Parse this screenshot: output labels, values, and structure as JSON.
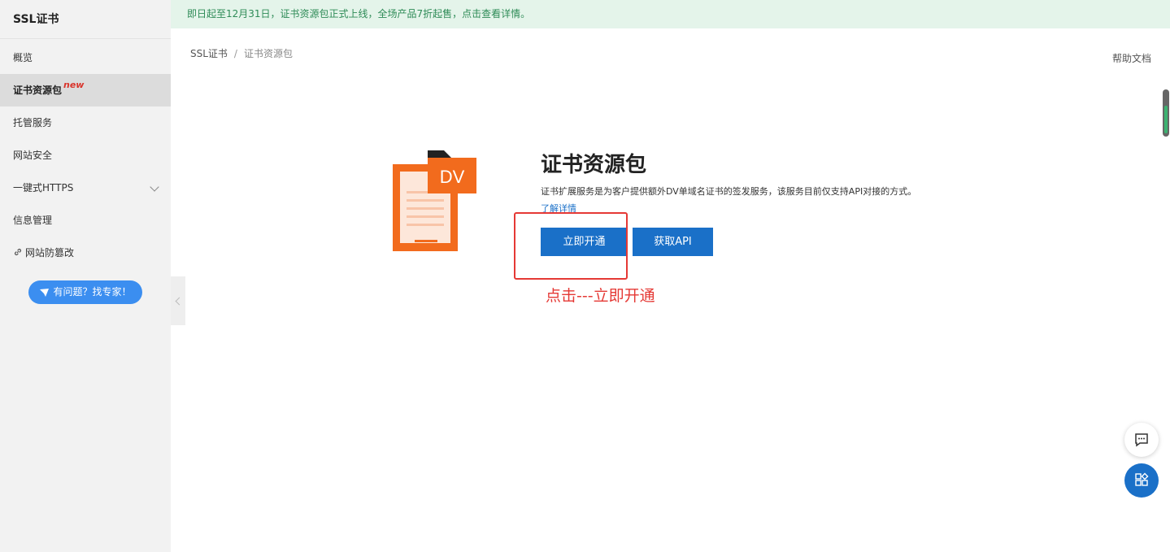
{
  "banner": {
    "text": "即日起至12月31日，证书资源包正式上线，全场产品7折起售，点击查看详情。"
  },
  "sidebar": {
    "title": "SSL证书",
    "items": [
      {
        "label": "概览"
      },
      {
        "label": "证书资源包",
        "badge": "new"
      },
      {
        "label": "托管服务"
      },
      {
        "label": "网站安全"
      },
      {
        "label": "一键式HTTPS"
      },
      {
        "label": "信息管理"
      },
      {
        "label": "网站防篡改"
      }
    ],
    "expert_button": "有问题？找专家！"
  },
  "breadcrumb": {
    "root": "SSL证书",
    "separator": "/",
    "current": "证书资源包"
  },
  "help_link": "帮助文档",
  "product": {
    "icon_badge": "DV",
    "title": "证书资源包",
    "description": "证书扩展服务是为客户提供额外DV单域名证书的签发服务，该服务目前仅支持API对接的方式。",
    "learn_more": "了解详情",
    "open_button": "立即开通",
    "api_button": "获取API"
  },
  "annotation": "点击---立即开通",
  "colors": {
    "primary": "#1a70c8",
    "annotation_red": "#e53935",
    "icon_orange": "#f26b1d",
    "banner_bg": "#e4f4ea"
  }
}
